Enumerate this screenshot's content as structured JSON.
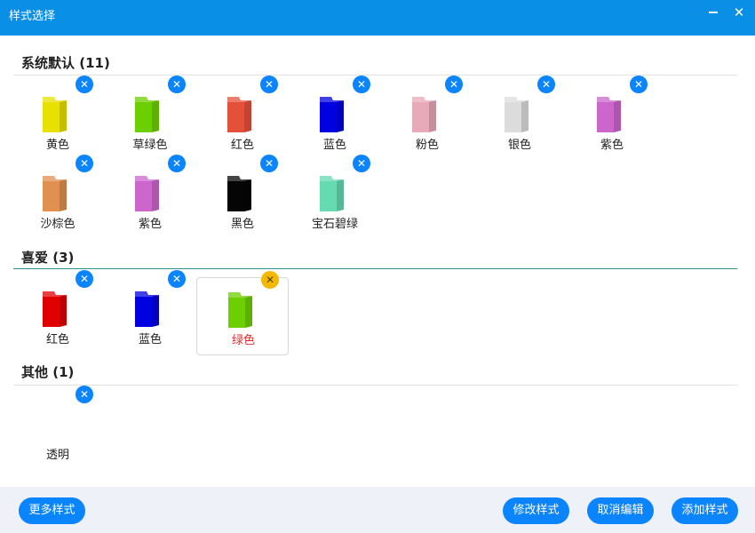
{
  "window": {
    "title": "样式选择",
    "min_icon": "minimize-icon",
    "close_icon": "close-icon",
    "close_glyph": "✕"
  },
  "sections": [
    {
      "name": "系统默认 (11)",
      "items": [
        {
          "label": "黄色",
          "color": "#e8e000"
        },
        {
          "label": "草绿色",
          "color": "#6ccf00"
        },
        {
          "label": "红色",
          "color": "#e5503a"
        },
        {
          "label": "蓝色",
          "color": "#0000e0"
        },
        {
          "label": "粉色",
          "color": "#e8aab8"
        },
        {
          "label": "银色",
          "color": "#dcdcdc"
        },
        {
          "label": "紫色",
          "color": "#cc66cc"
        },
        {
          "label": "沙棕色",
          "color": "#e09050"
        },
        {
          "label": "紫色",
          "color": "#cc66cc"
        },
        {
          "label": "黑色",
          "color": "#050505"
        },
        {
          "label": "宝石碧绿",
          "color": "#66dab0"
        }
      ]
    },
    {
      "name": "喜爱 (3)",
      "items": [
        {
          "label": "红色",
          "color": "#e00000"
        },
        {
          "label": "蓝色",
          "color": "#0000e0"
        },
        {
          "label": "绿色",
          "color": "#6ccf00",
          "selected": true
        }
      ]
    },
    {
      "name": "其他 (1)",
      "items": [
        {
          "label": "透明",
          "color": "transparent"
        }
      ]
    }
  ],
  "delete_glyph": "✕",
  "footer": {
    "more_styles": "更多样式",
    "modify_style": "修改样式",
    "cancel_edit": "取消编辑",
    "add_style": "添加样式"
  }
}
